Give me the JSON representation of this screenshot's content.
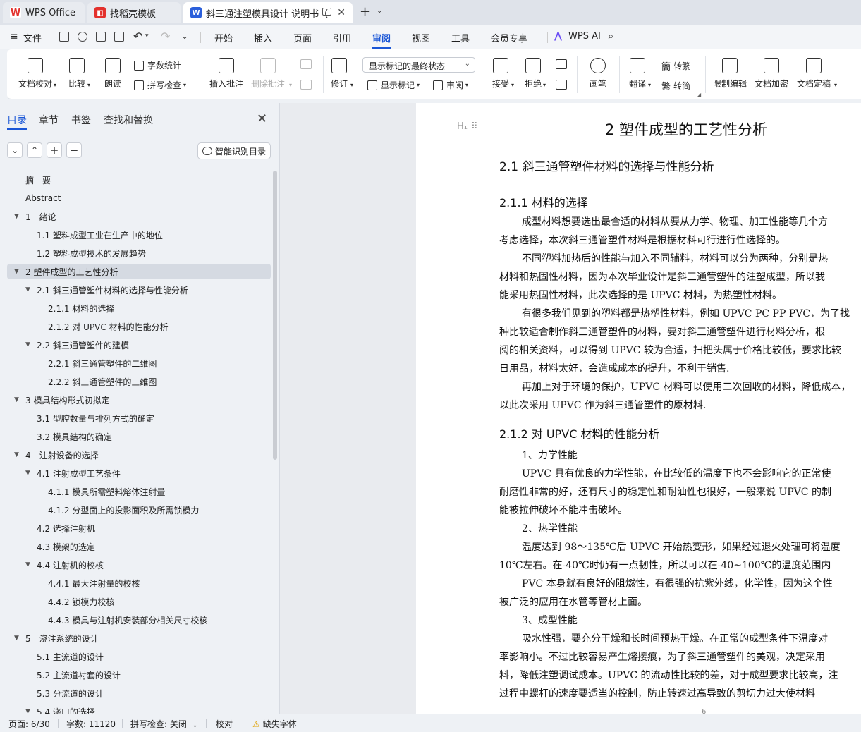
{
  "tabs": [
    {
      "label": "WPS Office"
    },
    {
      "label": "找稻壳模板"
    },
    {
      "label": "斜三通注塑模具设计 说明书（"
    }
  ],
  "menu": {
    "file": "文件",
    "items": [
      "开始",
      "插入",
      "页面",
      "引用",
      "审阅",
      "视图",
      "工具",
      "会员专享"
    ],
    "active": "审阅",
    "wps_ai": "WPS AI"
  },
  "ribbon": {
    "doc_proof": "文档校对",
    "compare": "比较",
    "read_aloud": "朗读",
    "word_count": "字数统计",
    "spell_check": "拼写检查",
    "insert_comment": "插入批注",
    "delete_comment": "删除批注",
    "track_changes": "修订",
    "display_select": "显示标记的最终状态",
    "show_markup": "显示标记",
    "review_pane": "审阅",
    "accept": "接受",
    "reject": "拒绝",
    "pen": "画笔",
    "translate": "翻译",
    "to_traditional": "转繁",
    "to_simplified": "转简",
    "restrict_edit": "限制编辑",
    "encrypt": "文档加密",
    "finalize": "文档定稿"
  },
  "nav": {
    "tabs": [
      "目录",
      "章节",
      "书签",
      "查找和替换"
    ],
    "smart_toc": "智能识别目录",
    "toc": [
      {
        "label": "摘　要",
        "level": 1,
        "caret": false
      },
      {
        "label": "Abstract",
        "level": 1,
        "caret": false
      },
      {
        "label": "1　绪论",
        "level": 1,
        "caret": true
      },
      {
        "label": "1.1  塑料成型工业在生产中的地位",
        "level": 2,
        "caret": false
      },
      {
        "label": "1.2  塑料成型技术的发展趋势",
        "level": 2,
        "caret": false
      },
      {
        "label": "2 塑件成型的工艺性分析",
        "level": 1,
        "caret": true,
        "selected": true
      },
      {
        "label": "2.1 斜三通管塑件材料的选择与性能分析",
        "level": 2,
        "caret": true
      },
      {
        "label": "2.1.1 材料的选择",
        "level": 3,
        "caret": false
      },
      {
        "label": "2.1.2  对 UPVC 材料的性能分析",
        "level": 3,
        "caret": false
      },
      {
        "label": "2.2 斜三通管塑件的建模",
        "level": 2,
        "caret": true
      },
      {
        "label": "2.2.1 斜三通管塑件的二维图",
        "level": 3,
        "caret": false
      },
      {
        "label": "2.2.2 斜三通管塑件的三维图",
        "level": 3,
        "caret": false
      },
      {
        "label": "3 模具结构形式初拟定",
        "level": 1,
        "caret": true
      },
      {
        "label": "3.1 型腔数量与排列方式的确定",
        "level": 2,
        "caret": false
      },
      {
        "label": "3.2 模具结构的确定",
        "level": 2,
        "caret": false
      },
      {
        "label": "4　注射设备的选择",
        "level": 1,
        "caret": true
      },
      {
        "label": "4.1  注射成型工艺条件",
        "level": 2,
        "caret": true
      },
      {
        "label": "4.1.1  模具所需塑料熔体注射量",
        "level": 3,
        "caret": false
      },
      {
        "label": "4.1.2  分型面上的投影面积及所需锁模力",
        "level": 3,
        "caret": false
      },
      {
        "label": "4.2  选择注射机",
        "level": 2,
        "caret": false
      },
      {
        "label": "4.3  模架的选定",
        "level": 2,
        "caret": false
      },
      {
        "label": "4.4  注射机的校核",
        "level": 2,
        "caret": true
      },
      {
        "label": "4.4.1  最大注射量的校核",
        "level": 3,
        "caret": false
      },
      {
        "label": "4.4.2  锁模力校核",
        "level": 3,
        "caret": false
      },
      {
        "label": "4.4.3  模具与注射机安装部分相关尺寸校核",
        "level": 3,
        "caret": false
      },
      {
        "label": "5　浇注系统的设计",
        "level": 1,
        "caret": true
      },
      {
        "label": "5.1  主流道的设计",
        "level": 2,
        "caret": false
      },
      {
        "label": "5.2  主流道衬套的设计",
        "level": 2,
        "caret": false
      },
      {
        "label": "5.3  分流道的设计",
        "level": 2,
        "caret": false
      },
      {
        "label": "5.4  浇口的选择",
        "level": 2,
        "caret": true
      }
    ]
  },
  "document": {
    "h1": "2 塑件成型的工艺性分析",
    "h1_marker": "H₁",
    "h2_1": "2.1 斜三通管塑件材料的选择与性能分析",
    "h3_1": "2.1.1 材料的选择",
    "h3_2": "2.1.2 对 UPVC 材料的性能分析",
    "lines": [
      {
        "text": "成型材料想要选出最合适的材料从要从力学、物理、加工性能等几个方",
        "indent": true
      },
      {
        "text": "考虑选择，本次斜三通管塑件材料是根据材料可行进行性选择的。",
        "indent": false
      },
      {
        "text": "不同塑料加热后的性能与加入不同辅料，材料可以分为两种，分别是热",
        "indent": true
      },
      {
        "text": "材料和热固性材料，因为本次毕业设计是斜三通管塑件的注塑成型，所以我",
        "indent": false
      },
      {
        "text": "能采用热固性材料，此次选择的是 UPVC 材料，为热塑性材料。",
        "indent": false
      },
      {
        "text": "有很多我们见到的塑料都是热塑性材料，例如 UPVC PC PP PVC，为了找",
        "indent": true
      },
      {
        "text": "种比较适合制作斜三通管塑件的材料，要对斜三通管塑件进行材料分析，根",
        "indent": false
      },
      {
        "text": "阅的相关资料，可以得到 UPVC 较为合适，扫把头属于价格比较低，要求比较",
        "indent": false
      },
      {
        "text": "日用品，材料太好，会造成成本的提升，不利于销售.",
        "indent": false
      },
      {
        "text": "再加上对于环境的保护，UPVC 材料可以使用二次回收的材料，降低成本，",
        "indent": true
      },
      {
        "text": "以此次采用 UPVC 作为斜三通管塑件的原材料.",
        "indent": false
      }
    ],
    "lines2": [
      {
        "text": "1、力学性能",
        "indent": true
      },
      {
        "text": "UPVC 具有优良的力学性能，在比较低的温度下也不会影响它的正常使",
        "indent": true
      },
      {
        "text": "耐磨性非常的好，还有尺寸的稳定性和耐油性也很好，一般来说 UPVC 的制",
        "indent": false
      },
      {
        "text": "能被拉伸破坏不能冲击破坏。",
        "indent": false
      },
      {
        "text": "2、热学性能",
        "indent": true
      },
      {
        "text": "温度达到 98～135℃后 UPVC 开始热变形，如果经过退火处理可将温度",
        "indent": true
      },
      {
        "text": "10℃左右。在-40℃时仍有一点韧性，所以可以在-40~100℃的温度范围内",
        "indent": false
      },
      {
        "text": "PVC 本身就有良好的阻燃性，有很强的抗紫外线，化学性，因为这个性",
        "indent": true
      },
      {
        "text": "被广泛的应用在水管等管材上面。",
        "indent": false
      },
      {
        "text": "3、成型性能",
        "indent": true
      },
      {
        "text": "吸水性强，要充分干燥和长时间预热干燥。在正常的成型条件下温度对",
        "indent": true
      },
      {
        "text": "率影响小。不过比较容易产生熔接痕，为了斜三通管塑件的美观，决定采用",
        "indent": false
      },
      {
        "text": "料，降低注塑调试成本。UPVC 的流动性比较的差，对于成型要求比较高，注",
        "indent": false
      },
      {
        "text": "过程中螺杆的速度要适当的控制，防止转速过高导致的剪切力过大使材料",
        "indent": false
      }
    ],
    "page_number": "6"
  },
  "status": {
    "page": "页面: 6/30",
    "words": "字数: 11120",
    "spell": "拼写检查: 关闭",
    "proof": "校对",
    "missing_font": "缺失字体"
  },
  "colors": {
    "accent": "#1a56d6",
    "wps_red": "#e3312d",
    "word_blue": "#2b5fdb"
  }
}
